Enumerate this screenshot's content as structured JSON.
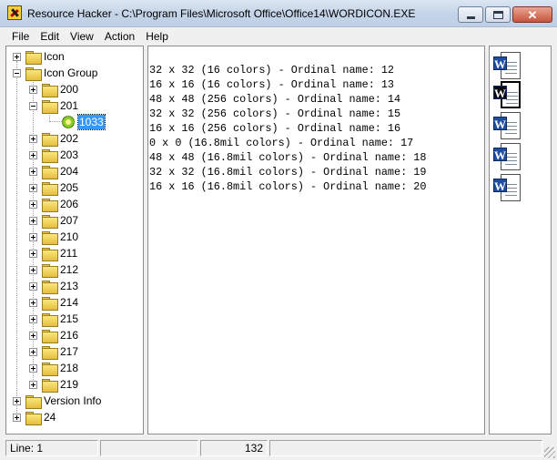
{
  "window": {
    "app_name": "Resource Hacker",
    "title": "Resource Hacker  -  C:\\Program Files\\Microsoft Office\\Office14\\WORDICON.EXE"
  },
  "menu": [
    "File",
    "Edit",
    "View",
    "Action",
    "Help"
  ],
  "tree": {
    "icon_label": "Icon",
    "icon_group_label": "Icon Group",
    "groups": [
      "200",
      "201",
      "202",
      "203",
      "204",
      "205",
      "206",
      "207",
      "210",
      "211",
      "212",
      "213",
      "214",
      "215",
      "216",
      "217",
      "218",
      "219"
    ],
    "selected_language": "1033",
    "version_info_label": "Version Info",
    "resource_24_label": "24"
  },
  "content": {
    "lines": [
      "32 x 32 (16 colors) - Ordinal name: 12",
      "16 x 16 (16 colors) - Ordinal name: 13",
      "48 x 48 (256 colors) - Ordinal name: 14",
      "32 x 32 (256 colors) - Ordinal name: 15",
      "16 x 16 (256 colors) - Ordinal name: 16",
      "0 x 0 (16.8mil colors) - Ordinal name: 17",
      "48 x 48 (16.8mil colors) - Ordinal name: 18",
      "32 x 32 (16.8mil colors) - Ordinal name: 19",
      "16 x 16 (16.8mil colors) - Ordinal name: 20"
    ]
  },
  "preview_icons": [
    "word-document-icon",
    "word-document-icon",
    "word-document-icon",
    "word-document-icon",
    "word-document-icon"
  ],
  "status": {
    "line": "Line: 1",
    "position": "132"
  },
  "colors": {
    "selection": "#3399ff",
    "word_blue": "#1f4ea1"
  }
}
